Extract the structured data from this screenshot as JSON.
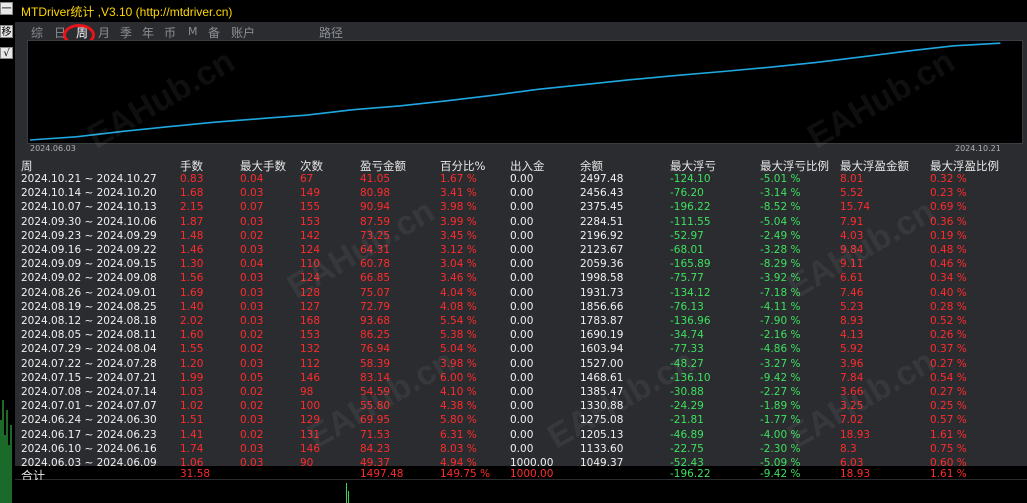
{
  "window": {
    "title": "MTDriver统计 ,V3.10 (http://mtdriver.cn)"
  },
  "side": {
    "btn1": "一",
    "btn2": "移",
    "btn3": "√"
  },
  "tabs": [
    {
      "label": "综",
      "active": false
    },
    {
      "label": "日",
      "active": false
    },
    {
      "label": "周",
      "active": true
    },
    {
      "label": "月",
      "active": false
    },
    {
      "label": "季",
      "active": false
    },
    {
      "label": "年",
      "active": false
    },
    {
      "label": "币",
      "active": false
    },
    {
      "label": "M",
      "active": false
    },
    {
      "label": "备",
      "active": false
    },
    {
      "label": "账户",
      "active": false
    },
    {
      "label": "路径",
      "active": false
    }
  ],
  "chart_data": {
    "type": "line",
    "x": [
      "2024.06.03",
      "2024.06.10",
      "2024.06.17",
      "2024.06.24",
      "2024.07.01",
      "2024.07.08",
      "2024.07.15",
      "2024.07.22",
      "2024.07.29",
      "2024.08.05",
      "2024.08.12",
      "2024.08.19",
      "2024.08.26",
      "2024.09.02",
      "2024.09.09",
      "2024.09.16",
      "2024.09.23",
      "2024.09.30",
      "2024.10.07",
      "2024.10.14",
      "2024.10.21"
    ],
    "series": [
      {
        "values": [
          1049.37,
          1133.6,
          1205.13,
          1275.08,
          1330.88,
          1385.47,
          1468.61,
          1527.0,
          1603.94,
          1690.19,
          1783.87,
          1856.66,
          1931.73,
          1998.58,
          2059.36,
          2123.67,
          2196.92,
          2284.51,
          2375.45,
          2456.43,
          2497.48
        ],
        "color": "#1fa8e0"
      }
    ],
    "x_start_label": "2024.06.03",
    "x_end_label": "2024.10.21"
  },
  "table": {
    "headers": [
      "周",
      "手数",
      "最大手数",
      "次数",
      "盈亏金额",
      "百分比%",
      "出入金",
      "余额",
      "最大浮亏",
      "最大浮亏比例",
      "最大浮盈金额",
      "最大浮盈比例"
    ],
    "rows": [
      [
        "2024.10.21 ~ 2024.10.27",
        "0.83",
        "0.04",
        "67",
        "41.05",
        "1.67 %",
        "0.00",
        "2497.48",
        "-124.10",
        "-5.01 %",
        "8.01",
        "0.32 %"
      ],
      [
        "2024.10.14 ~ 2024.10.20",
        "1.68",
        "0.03",
        "149",
        "80.98",
        "3.41 %",
        "0.00",
        "2456.43",
        "-76.20",
        "-3.14 %",
        "5.52",
        "0.23 %"
      ],
      [
        "2024.10.07 ~ 2024.10.13",
        "2.15",
        "0.07",
        "155",
        "90.94",
        "3.98 %",
        "0.00",
        "2375.45",
        "-196.22",
        "-8.52 %",
        "15.74",
        "0.69 %"
      ],
      [
        "2024.09.30 ~ 2024.10.06",
        "1.87",
        "0.03",
        "153",
        "87.59",
        "3.99 %",
        "0.00",
        "2284.51",
        "-111.55",
        "-5.04 %",
        "7.91",
        "0.36 %"
      ],
      [
        "2024.09.23 ~ 2024.09.29",
        "1.48",
        "0.02",
        "142",
        "73.25",
        "3.45 %",
        "0.00",
        "2196.92",
        "-52.97",
        "-2.49 %",
        "4.03",
        "0.19 %"
      ],
      [
        "2024.09.16 ~ 2024.09.22",
        "1.46",
        "0.03",
        "124",
        "64.31",
        "3.12 %",
        "0.00",
        "2123.67",
        "-68.01",
        "-3.28 %",
        "9.84",
        "0.48 %"
      ],
      [
        "2024.09.09 ~ 2024.09.15",
        "1.30",
        "0.04",
        "110",
        "60.78",
        "3.04 %",
        "0.00",
        "2059.36",
        "-165.89",
        "-8.29 %",
        "9.11",
        "0.46 %"
      ],
      [
        "2024.09.02 ~ 2024.09.08",
        "1.56",
        "0.03",
        "124",
        "66.85",
        "3.46 %",
        "0.00",
        "1998.58",
        "-75.77",
        "-3.92 %",
        "6.61",
        "0.34 %"
      ],
      [
        "2024.08.26 ~ 2024.09.01",
        "1.69",
        "0.03",
        "128",
        "75.07",
        "4.04 %",
        "0.00",
        "1931.73",
        "-134.12",
        "-7.18 %",
        "7.46",
        "0.40 %"
      ],
      [
        "2024.08.19 ~ 2024.08.25",
        "1.40",
        "0.03",
        "127",
        "72.79",
        "4.08 %",
        "0.00",
        "1856.66",
        "-76.13",
        "-4.11 %",
        "5.23",
        "0.28 %"
      ],
      [
        "2024.08.12 ~ 2024.08.18",
        "2.02",
        "0.03",
        "168",
        "93.68",
        "5.54 %",
        "0.00",
        "1783.87",
        "-136.96",
        "-7.90 %",
        "8.93",
        "0.52 %"
      ],
      [
        "2024.08.05 ~ 2024.08.11",
        "1.60",
        "0.02",
        "153",
        "86.25",
        "5.38 %",
        "0.00",
        "1690.19",
        "-34.74",
        "-2.16 %",
        "4.13",
        "0.26 %"
      ],
      [
        "2024.07.29 ~ 2024.08.04",
        "1.55",
        "0.02",
        "132",
        "76.94",
        "5.04 %",
        "0.00",
        "1603.94",
        "-77.33",
        "-4.86 %",
        "5.92",
        "0.37 %"
      ],
      [
        "2024.07.22 ~ 2024.07.28",
        "1.20",
        "0.03",
        "112",
        "58.39",
        "3.98 %",
        "0.00",
        "1527.00",
        "-48.27",
        "-3.27 %",
        "3.96",
        "0.27 %"
      ],
      [
        "2024.07.15 ~ 2024.07.21",
        "1.99",
        "0.05",
        "146",
        "83.14",
        "6.00 %",
        "0.00",
        "1468.61",
        "-136.10",
        "-9.42 %",
        "7.84",
        "0.54 %"
      ],
      [
        "2024.07.08 ~ 2024.07.14",
        "1.03",
        "0.02",
        "98",
        "54.59",
        "4.10 %",
        "0.00",
        "1385.47",
        "-30.88",
        "-2.27 %",
        "3.66",
        "0.27 %"
      ],
      [
        "2024.07.01 ~ 2024.07.07",
        "1.02",
        "0.02",
        "100",
        "55.80",
        "4.38 %",
        "0.00",
        "1330.88",
        "-24.29",
        "-1.89 %",
        "3.25",
        "0.25 %"
      ],
      [
        "2024.06.24 ~ 2024.06.30",
        "1.51",
        "0.03",
        "129",
        "69.95",
        "5.80 %",
        "0.00",
        "1275.08",
        "-21.81",
        "-1.77 %",
        "7.02",
        "0.57 %"
      ],
      [
        "2024.06.17 ~ 2024.06.23",
        "1.41",
        "0.02",
        "131",
        "71.53",
        "6.31 %",
        "0.00",
        "1205.13",
        "-46.89",
        "-4.00 %",
        "18.93",
        "1.61 %"
      ],
      [
        "2024.06.10 ~ 2024.06.16",
        "1.74",
        "0.03",
        "146",
        "84.23",
        "8.03 %",
        "0.00",
        "1133.60",
        "-22.75",
        "-2.30 %",
        "8.3",
        "0.75 %"
      ],
      [
        "2024.06.03 ~ 2024.06.09",
        "1.06",
        "0.03",
        "90",
        "49.37",
        "4.94 %",
        "1000.00",
        "1049.37",
        "-52.43",
        "-5.09 %",
        "6.03",
        "0.60 %"
      ]
    ],
    "total": {
      "label": "合计",
      "lots": "31.58",
      "pnl": "1497.48",
      "pct": "149.75 %",
      "deposit": "1000.00",
      "max_float_loss": "-196.22",
      "max_float_loss_pct": "-9.42 %",
      "max_float_profit": "18.93",
      "max_float_profit_pct": "1.61 %"
    }
  },
  "watermark": "EAHub.cn"
}
